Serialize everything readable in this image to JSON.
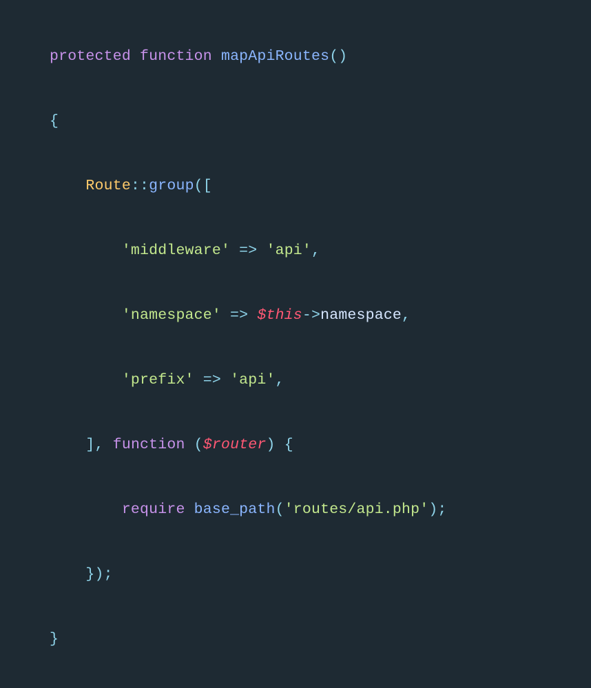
{
  "code": {
    "l1": {
      "kw1": "protected",
      "sp": " ",
      "kw2": "function",
      "fn": "mapApiRoutes",
      "paren": "()"
    },
    "l2": {
      "brace": "{"
    },
    "l3": {
      "pad": "    ",
      "cls": "Route",
      "op": "::",
      "fn": "group",
      "open": "(["
    },
    "l4": {
      "pad": "        ",
      "k": "'middleware'",
      "arw": " => ",
      "v": "'api'",
      "end": ","
    },
    "l5": {
      "pad": "        ",
      "k": "'namespace'",
      "arw": " => ",
      "var": "$this",
      "obj": "->",
      "prop": "namespace",
      "end": ","
    },
    "l6": {
      "pad": "        ",
      "k": "'prefix'",
      "arw": " => ",
      "v": "'api'",
      "end": ","
    },
    "l7": {
      "pad": "    ",
      "close": "], ",
      "kw": "function",
      "sp": " ",
      "paren": "(",
      "var": "$router",
      "after": ") {"
    },
    "l8": {
      "pad": "        ",
      "kw": "require",
      "sp": " ",
      "fn": "base_path",
      "open": "(",
      "str": "'routes/api.php'",
      "close": ");"
    },
    "l9": {
      "pad": "    ",
      "end": "});"
    },
    "l10": {
      "brace": "}"
    }
  }
}
